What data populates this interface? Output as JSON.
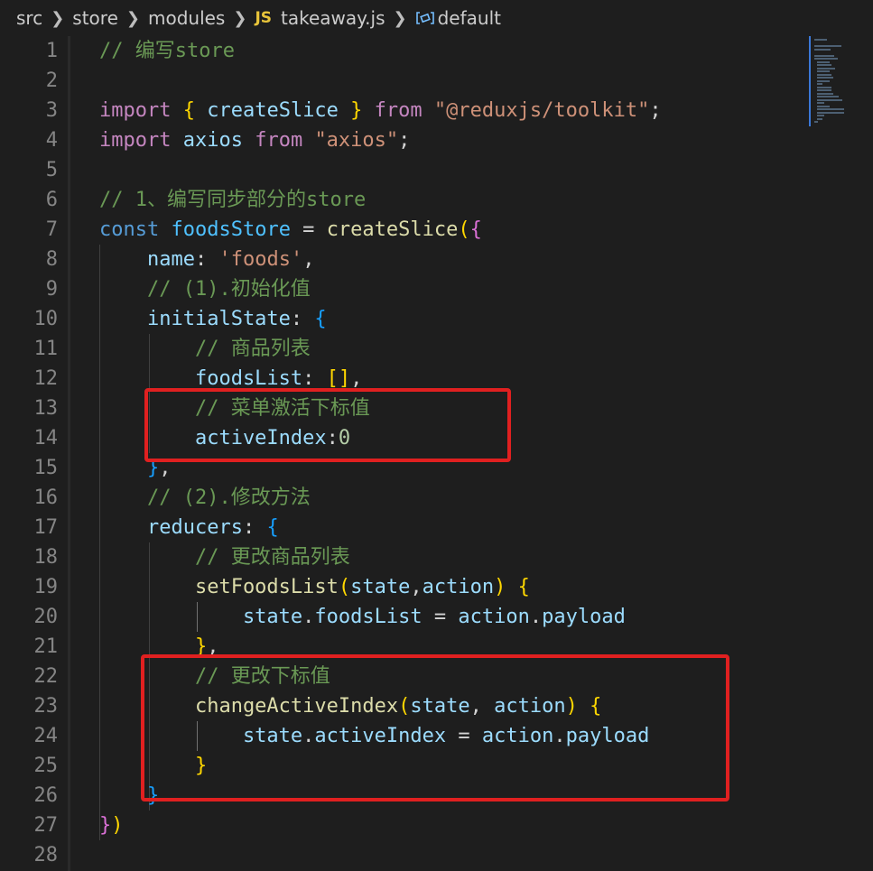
{
  "breadcrumb": {
    "src": "src",
    "store": "store",
    "modules": "modules",
    "file_badge": "JS",
    "file": "takeaway.js",
    "symbol": "default"
  },
  "lines": [
    {
      "n": "1",
      "tokens": [
        {
          "t": "// 编写store",
          "c": "c-com"
        }
      ]
    },
    {
      "n": "2",
      "tokens": []
    },
    {
      "n": "3",
      "tokens": [
        {
          "t": "import",
          "c": "c-kw"
        },
        {
          "t": " ",
          "c": "c-p"
        },
        {
          "t": "{",
          "c": "b1"
        },
        {
          "t": " createSlice ",
          "c": "c-var"
        },
        {
          "t": "}",
          "c": "b1"
        },
        {
          "t": " ",
          "c": "c-p"
        },
        {
          "t": "from",
          "c": "c-kw"
        },
        {
          "t": " ",
          "c": "c-p"
        },
        {
          "t": "\"@reduxjs/toolkit\"",
          "c": "c-str"
        },
        {
          "t": ";",
          "c": "c-p"
        }
      ]
    },
    {
      "n": "4",
      "tokens": [
        {
          "t": "import",
          "c": "c-kw"
        },
        {
          "t": " axios ",
          "c": "c-var"
        },
        {
          "t": "from",
          "c": "c-kw"
        },
        {
          "t": " ",
          "c": "c-p"
        },
        {
          "t": "\"axios\"",
          "c": "c-str"
        },
        {
          "t": ";",
          "c": "c-p"
        }
      ]
    },
    {
      "n": "5",
      "tokens": []
    },
    {
      "n": "6",
      "tokens": [
        {
          "t": "// 1、编写同步部分的store",
          "c": "c-com"
        }
      ]
    },
    {
      "n": "7",
      "tokens": [
        {
          "t": "const",
          "c": "c-dec"
        },
        {
          "t": " ",
          "c": "c-p"
        },
        {
          "t": "foodsStore",
          "c": "c-cls"
        },
        {
          "t": " = ",
          "c": "c-p"
        },
        {
          "t": "createSlice",
          "c": "c-fn"
        },
        {
          "t": "(",
          "c": "b1"
        },
        {
          "t": "{",
          "c": "b2"
        }
      ]
    },
    {
      "n": "8",
      "tokens": [
        {
          "t": "    name",
          "c": "c-var"
        },
        {
          "t": ": ",
          "c": "c-p"
        },
        {
          "t": "'foods'",
          "c": "c-str"
        },
        {
          "t": ",",
          "c": "c-p"
        }
      ]
    },
    {
      "n": "9",
      "tokens": [
        {
          "t": "    // (1).初始化值",
          "c": "c-com"
        }
      ]
    },
    {
      "n": "10",
      "tokens": [
        {
          "t": "    initialState",
          "c": "c-var"
        },
        {
          "t": ": ",
          "c": "c-p"
        },
        {
          "t": "{",
          "c": "b3"
        }
      ]
    },
    {
      "n": "11",
      "tokens": [
        {
          "t": "        // 商品列表",
          "c": "c-com"
        }
      ]
    },
    {
      "n": "12",
      "tokens": [
        {
          "t": "        foodsList",
          "c": "c-var"
        },
        {
          "t": ": ",
          "c": "c-p"
        },
        {
          "t": "[]",
          "c": "b1"
        },
        {
          "t": ",",
          "c": "c-p"
        }
      ]
    },
    {
      "n": "13",
      "tokens": [
        {
          "t": "        // 菜单激活下标值",
          "c": "c-com"
        }
      ]
    },
    {
      "n": "14",
      "tokens": [
        {
          "t": "        activeIndex",
          "c": "c-var"
        },
        {
          "t": ":",
          "c": "c-p"
        },
        {
          "t": "0",
          "c": "c-num"
        }
      ]
    },
    {
      "n": "15",
      "tokens": [
        {
          "t": "    ",
          "c": "c-p"
        },
        {
          "t": "}",
          "c": "b3"
        },
        {
          "t": ",",
          "c": "c-p"
        }
      ]
    },
    {
      "n": "16",
      "tokens": [
        {
          "t": "    // (2).修改方法",
          "c": "c-com"
        }
      ]
    },
    {
      "n": "17",
      "tokens": [
        {
          "t": "    reducers",
          "c": "c-var"
        },
        {
          "t": ": ",
          "c": "c-p"
        },
        {
          "t": "{",
          "c": "b3"
        }
      ]
    },
    {
      "n": "18",
      "tokens": [
        {
          "t": "        // 更改商品列表",
          "c": "c-com"
        }
      ]
    },
    {
      "n": "19",
      "tokens": [
        {
          "t": "        setFoodsList",
          "c": "c-fn"
        },
        {
          "t": "(",
          "c": "b1"
        },
        {
          "t": "state",
          "c": "c-var"
        },
        {
          "t": ",",
          "c": "c-p"
        },
        {
          "t": "action",
          "c": "c-var"
        },
        {
          "t": ")",
          "c": "b1"
        },
        {
          "t": " ",
          "c": "c-p"
        },
        {
          "t": "{",
          "c": "b1"
        }
      ]
    },
    {
      "n": "20",
      "tokens": [
        {
          "t": "            state",
          "c": "c-var"
        },
        {
          "t": ".",
          "c": "c-p"
        },
        {
          "t": "foodsList",
          "c": "c-var"
        },
        {
          "t": " = ",
          "c": "c-p"
        },
        {
          "t": "action",
          "c": "c-var"
        },
        {
          "t": ".",
          "c": "c-p"
        },
        {
          "t": "payload",
          "c": "c-var"
        }
      ]
    },
    {
      "n": "21",
      "tokens": [
        {
          "t": "        ",
          "c": "c-p"
        },
        {
          "t": "}",
          "c": "b1"
        },
        {
          "t": ",",
          "c": "c-p"
        }
      ]
    },
    {
      "n": "22",
      "tokens": [
        {
          "t": "        // 更改下标值",
          "c": "c-com"
        }
      ]
    },
    {
      "n": "23",
      "tokens": [
        {
          "t": "        changeActiveIndex",
          "c": "c-fn"
        },
        {
          "t": "(",
          "c": "b1"
        },
        {
          "t": "state",
          "c": "c-var"
        },
        {
          "t": ", ",
          "c": "c-p"
        },
        {
          "t": "action",
          "c": "c-var"
        },
        {
          "t": ")",
          "c": "b1"
        },
        {
          "t": " ",
          "c": "c-p"
        },
        {
          "t": "{",
          "c": "b1"
        }
      ]
    },
    {
      "n": "24",
      "tokens": [
        {
          "t": "            state",
          "c": "c-var"
        },
        {
          "t": ".",
          "c": "c-p"
        },
        {
          "t": "activeIndex",
          "c": "c-var"
        },
        {
          "t": " = ",
          "c": "c-p"
        },
        {
          "t": "action",
          "c": "c-var"
        },
        {
          "t": ".",
          "c": "c-p"
        },
        {
          "t": "payload",
          "c": "c-var"
        }
      ]
    },
    {
      "n": "25",
      "tokens": [
        {
          "t": "        ",
          "c": "c-p"
        },
        {
          "t": "}",
          "c": "b1"
        }
      ]
    },
    {
      "n": "26",
      "tokens": [
        {
          "t": "    ",
          "c": "c-p"
        },
        {
          "t": "}",
          "c": "b3"
        }
      ]
    },
    {
      "n": "27",
      "tokens": [
        {
          "t": "}",
          "c": "b2"
        },
        {
          "t": ")",
          "c": "b1"
        }
      ]
    },
    {
      "n": "28",
      "tokens": []
    }
  ],
  "colors": {
    "background": "#1e1e1e",
    "highlight_box": "#e02020",
    "comment": "#6a9955",
    "keyword": "#c586c0"
  }
}
